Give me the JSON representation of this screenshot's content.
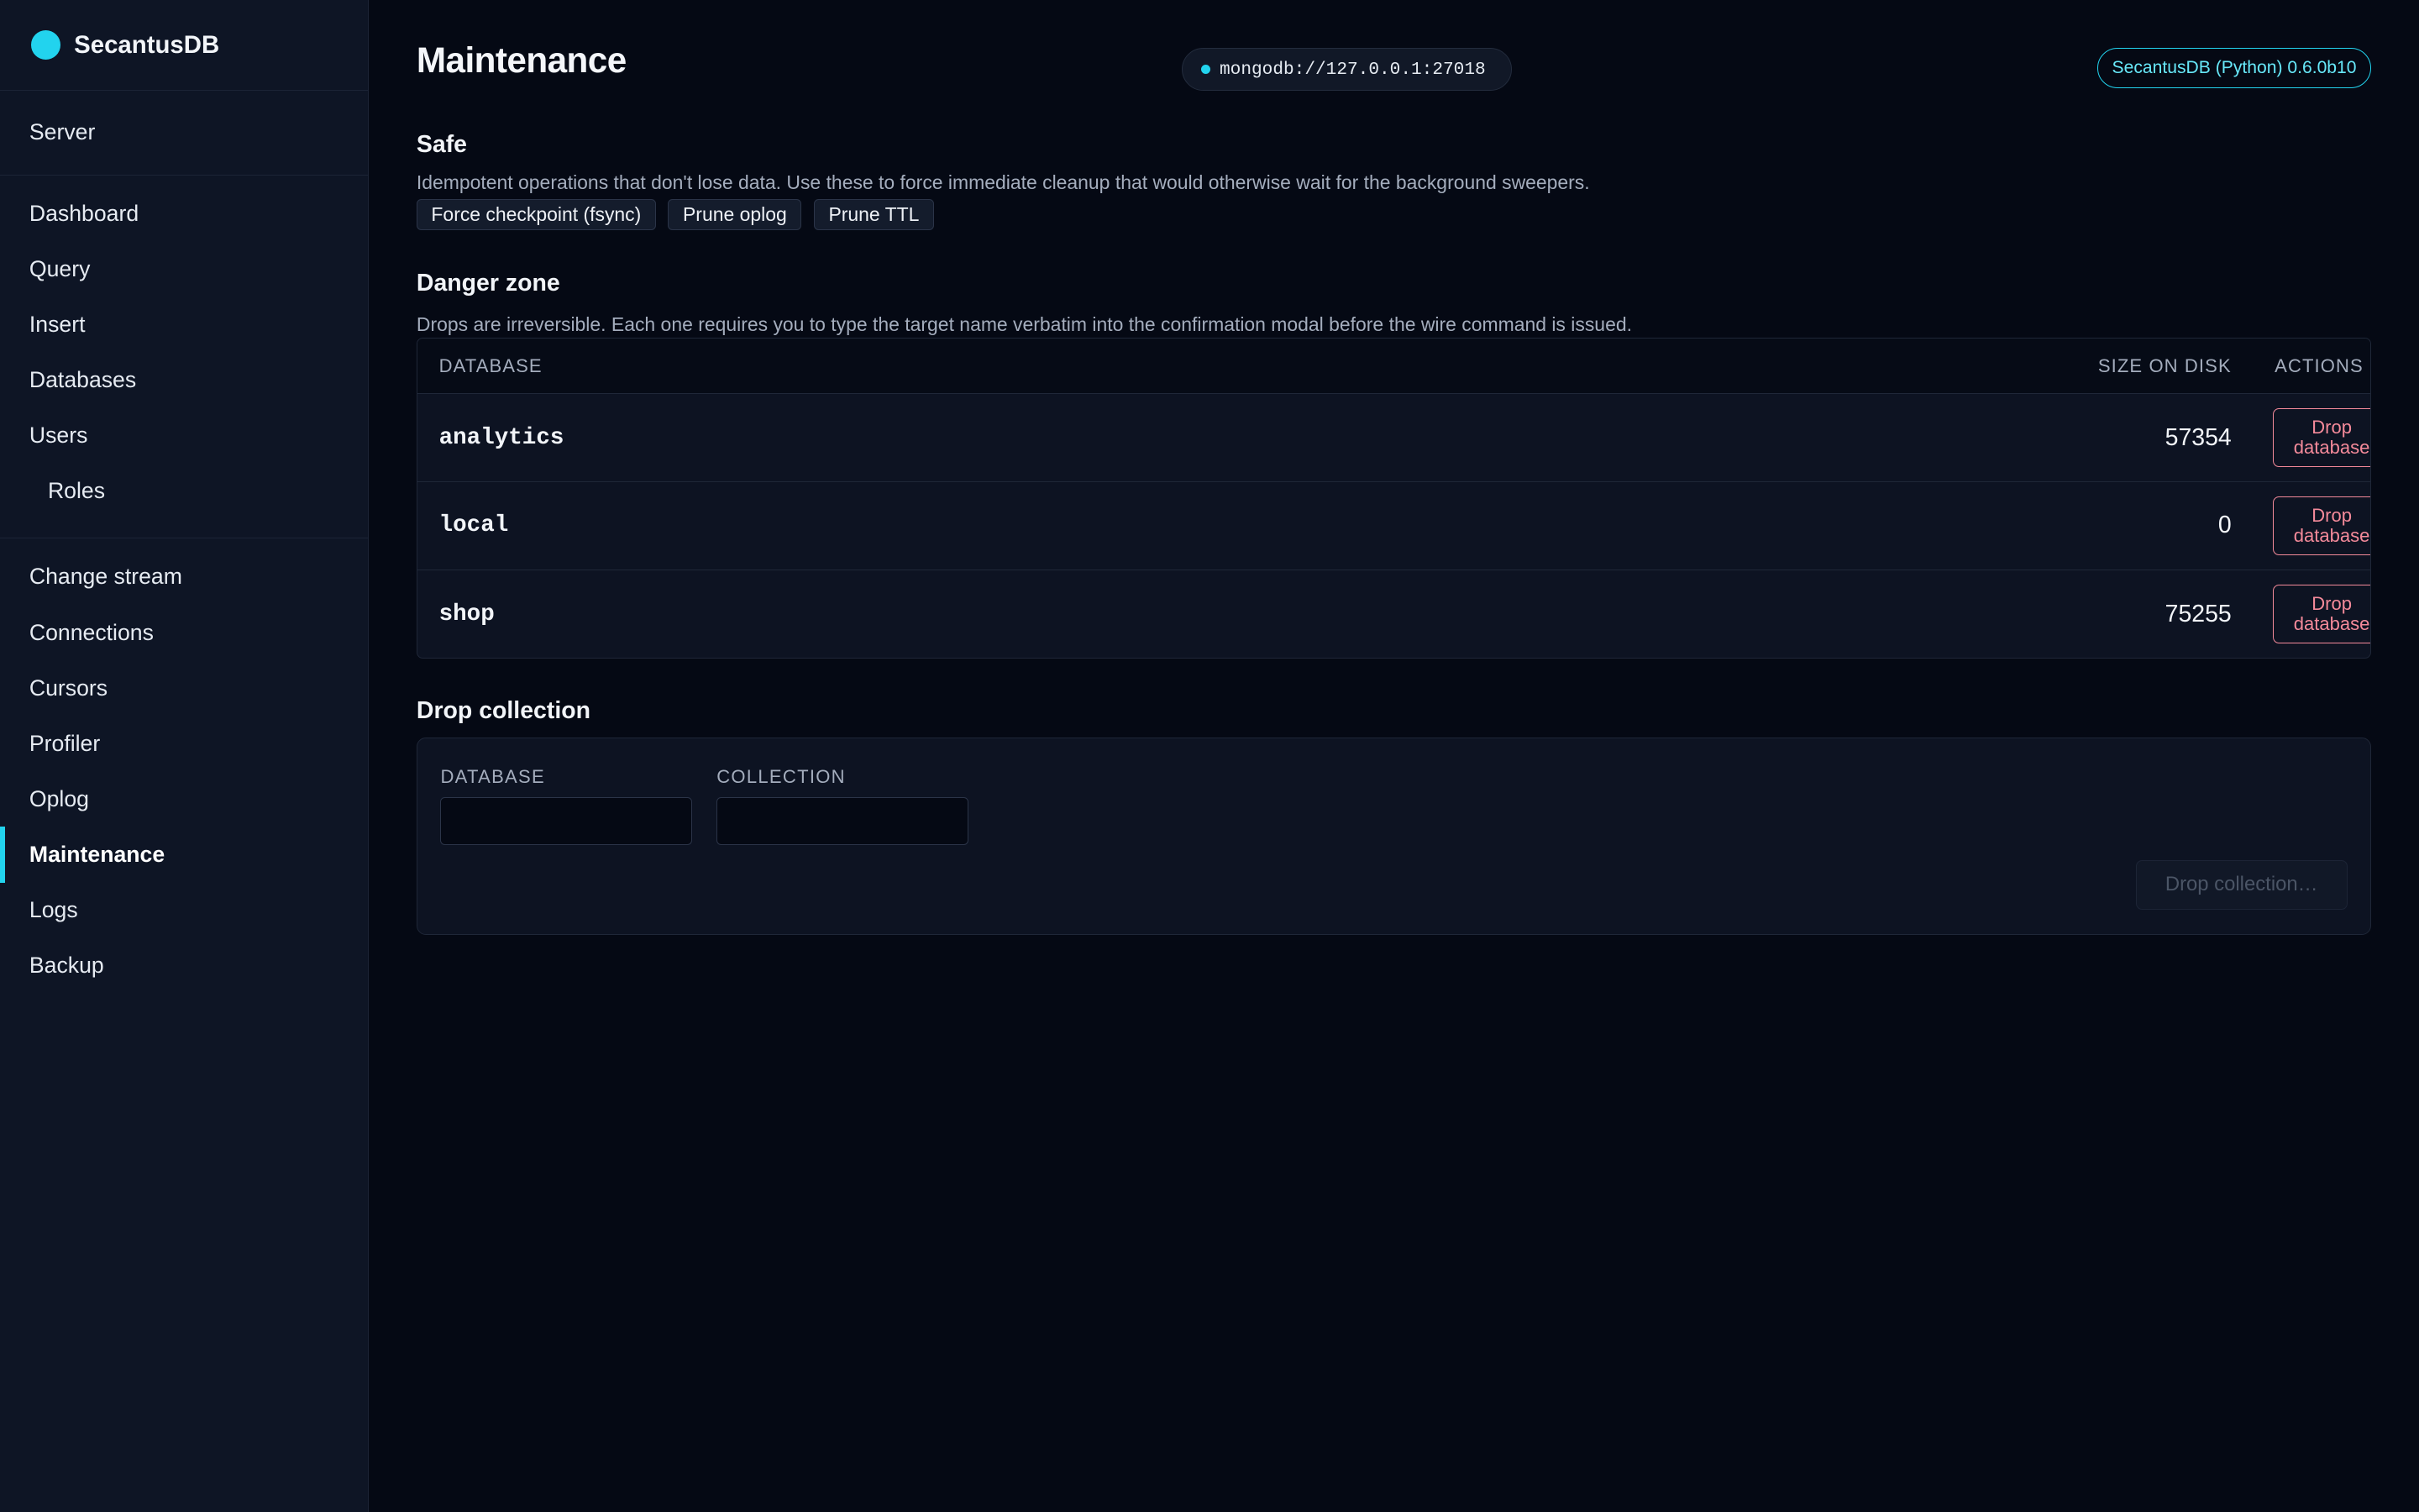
{
  "app": {
    "name": "SecantusDB",
    "accent": "#22d3ee",
    "danger": "#f48a9a"
  },
  "sidebar": {
    "groups": [
      [
        {
          "label": "Server"
        }
      ],
      [
        {
          "label": "Dashboard"
        },
        {
          "label": "Query"
        },
        {
          "label": "Insert"
        },
        {
          "label": "Databases"
        },
        {
          "label": "Users"
        },
        {
          "label": "Roles"
        }
      ],
      [
        {
          "label": "Change stream"
        },
        {
          "label": "Connections"
        },
        {
          "label": "Cursors"
        },
        {
          "label": "Profiler"
        },
        {
          "label": "Oplog"
        },
        {
          "label": "Maintenance"
        },
        {
          "label": "Logs"
        },
        {
          "label": "Backup"
        }
      ]
    ],
    "active": "Maintenance"
  },
  "header": {
    "title": "Maintenance",
    "connection": "mongodb://127.0.0.1:27018",
    "version": "SecantusDB (Python) 0.6.0b10"
  },
  "safe": {
    "title": "Safe",
    "description": "Idempotent operations that don't lose data. Use these to force immediate cleanup that would otherwise wait for the background sweepers.",
    "buttons": [
      "Force checkpoint (fsync)",
      "Prune oplog",
      "Prune TTL"
    ]
  },
  "danger": {
    "title": "Danger zone",
    "description": "Drops are irreversible. Each one requires you to type the target name verbatim into the confirmation modal before the wire command is issued.",
    "columns": {
      "database": "DATABASE",
      "size": "SIZE ON DISK",
      "actions": "ACTIONS"
    },
    "rows": [
      {
        "name": "analytics",
        "size": "57354",
        "action": "Drop database"
      },
      {
        "name": "local",
        "size": "0",
        "action": "Drop database"
      },
      {
        "name": "shop",
        "size": "75255",
        "action": "Drop database"
      }
    ]
  },
  "drop_collection": {
    "title": "Drop collection",
    "database_label": "DATABASE",
    "database_value": "",
    "collection_label": "COLLECTION",
    "collection_value": "",
    "button": "Drop collection…"
  }
}
